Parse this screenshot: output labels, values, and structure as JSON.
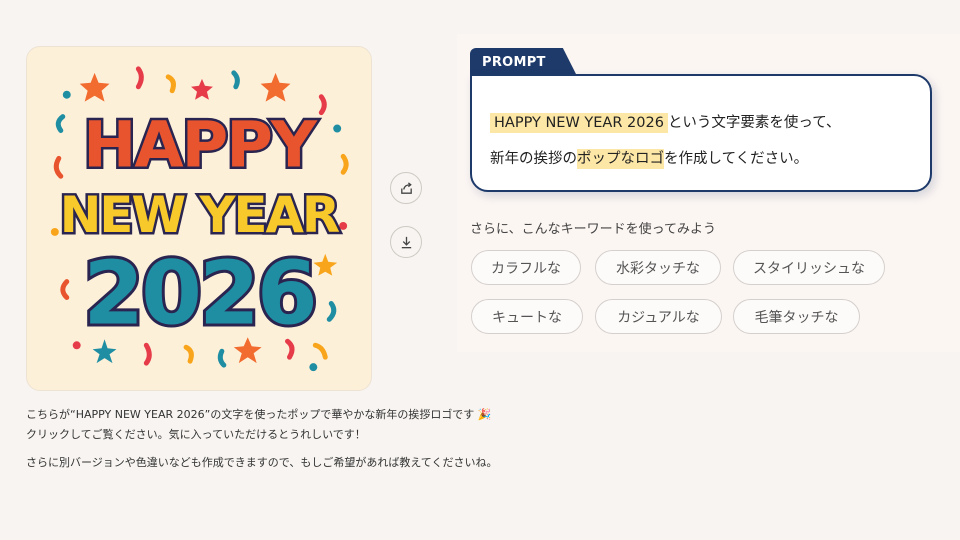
{
  "logo": {
    "line1": "HAPPY",
    "line2": "NEW YEAR",
    "line3": "2026",
    "colors": {
      "background": "#fdf0d9",
      "line1": "#e8542e",
      "line2": "#f8c92a",
      "line3": "#1f8ea3",
      "outline": "#2a2550"
    }
  },
  "actions": {
    "share_icon": "share-icon",
    "download_icon": "download-icon"
  },
  "message": {
    "line1": "こちらが“HAPPY NEW YEAR 2026”の文字を使ったポップで華やかな新年の挨拶ロゴです 🎉",
    "line2": "クリックしてご覧ください。気に入っていただけるとうれしいです！",
    "line3": "さらに別バージョンや色違いなども作成できますので、もしご希望があれば教えてくださいね。"
  },
  "prompt": {
    "tab_label": "PROMPT",
    "highlight1": "HAPPY NEW YEAR 2026",
    "text1": "という文字要素を使って、",
    "text2a": "新年の挨拶の",
    "highlight2": "ポップなロゴ",
    "text2b": "を作成してください。"
  },
  "keywords": {
    "title": "さらに、こんなキーワードを使ってみよう",
    "chips": [
      "カラフルな",
      "水彩タッチな",
      "スタイリッシュな",
      "キュートな",
      "カジュアルな",
      "毛筆タッチな"
    ]
  },
  "colors": {
    "accent": "#1e3a6a",
    "highlight": "#fde7a6"
  }
}
